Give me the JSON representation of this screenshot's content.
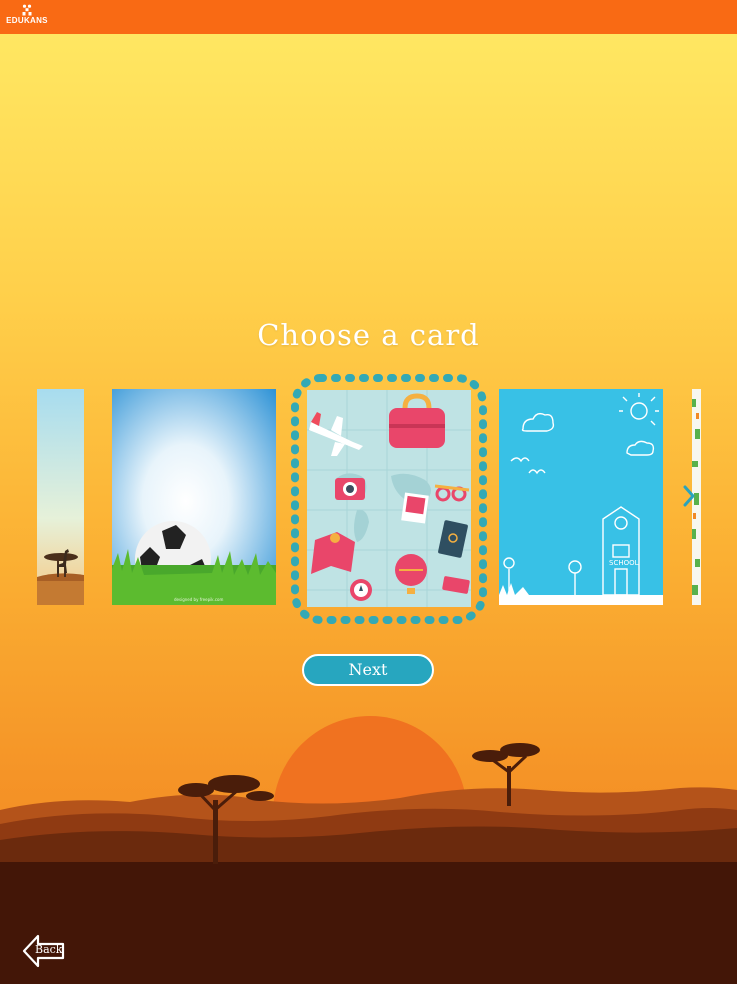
{
  "header": {
    "logo_text": "EDUKANS",
    "logo_icon": "edukans-figure-icon",
    "bar_color": "#f96a14"
  },
  "main": {
    "title": "Choose a card",
    "cards": [
      {
        "name": "savanna-giraffe-card",
        "selected": false,
        "visibility": "partial"
      },
      {
        "name": "soccer-ball-grass-card",
        "selected": false,
        "watermark": "designed by freepik.com"
      },
      {
        "name": "travel-icons-card",
        "selected": true
      },
      {
        "name": "school-doodle-card",
        "selected": false
      },
      {
        "name": "green-pattern-card",
        "selected": false,
        "visibility": "partial"
      }
    ],
    "next_arrow_icon": "chevron-right-icon",
    "next_button_label": "Next",
    "accent_color": "#27a6bf"
  },
  "footer": {
    "back_button_label": "Back",
    "back_icon": "arrow-left-icon"
  }
}
